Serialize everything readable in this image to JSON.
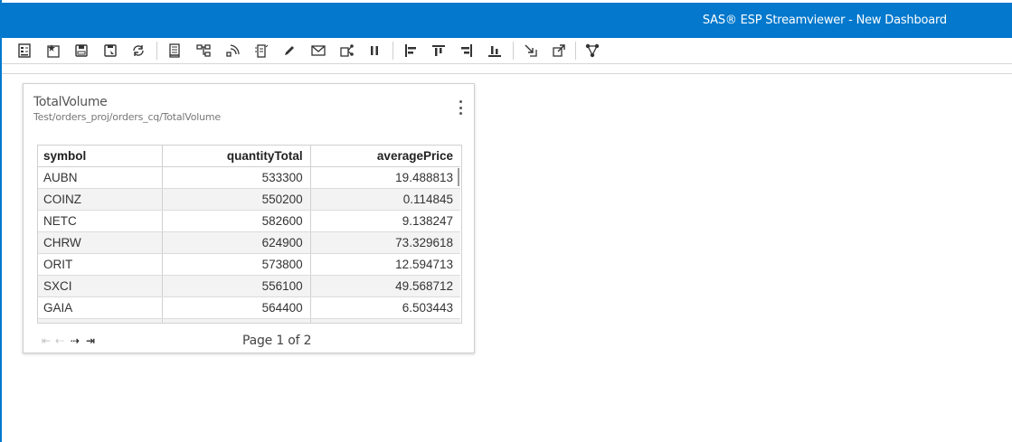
{
  "app": {
    "title": "SAS® ESP Streamviewer - New Dashboard",
    "accent_color": "#0378cd"
  },
  "toolbar": {
    "buttons": [
      {
        "icon": "dashboard-list-icon"
      },
      {
        "icon": "new-dashboard-icon"
      },
      {
        "icon": "save-icon"
      },
      {
        "icon": "save-as-icon"
      },
      {
        "icon": "refresh-icon"
      },
      {
        "icon": "document-icon"
      },
      {
        "icon": "model-tree-icon"
      },
      {
        "icon": "stream-icon"
      },
      {
        "icon": "publish-icon"
      },
      {
        "icon": "edit-icon"
      },
      {
        "icon": "mail-icon"
      },
      {
        "icon": "share-icon"
      },
      {
        "icon": "pause-icon"
      },
      {
        "icon": "align-left-icon"
      },
      {
        "icon": "align-top-icon"
      },
      {
        "icon": "align-right-icon"
      },
      {
        "icon": "align-bottom-icon"
      },
      {
        "icon": "import-icon"
      },
      {
        "icon": "export-icon"
      },
      {
        "icon": "graph-icon"
      }
    ]
  },
  "widget": {
    "title": "TotalVolume",
    "subtitle": "Test/orders_proj/orders_cq/TotalVolume",
    "columns": [
      "symbol",
      "quantityTotal",
      "averagePrice"
    ],
    "rows": [
      [
        "AUBN",
        "533300",
        "19.488813"
      ],
      [
        "COINZ",
        "550200",
        "0.114845"
      ],
      [
        "NETC",
        "582600",
        "9.138247"
      ],
      [
        "CHRW",
        "624900",
        "73.329618"
      ],
      [
        "ORIT",
        "573800",
        "12.594713"
      ],
      [
        "SXCI",
        "556100",
        "49.568712"
      ],
      [
        "GAIA",
        "564400",
        "6.503443"
      ],
      [
        "",
        "",
        ""
      ]
    ],
    "pager": {
      "first": "⇤",
      "prev": "⇠",
      "next": "⇢",
      "last": "⇥",
      "label": "Page 1 of 2"
    }
  }
}
